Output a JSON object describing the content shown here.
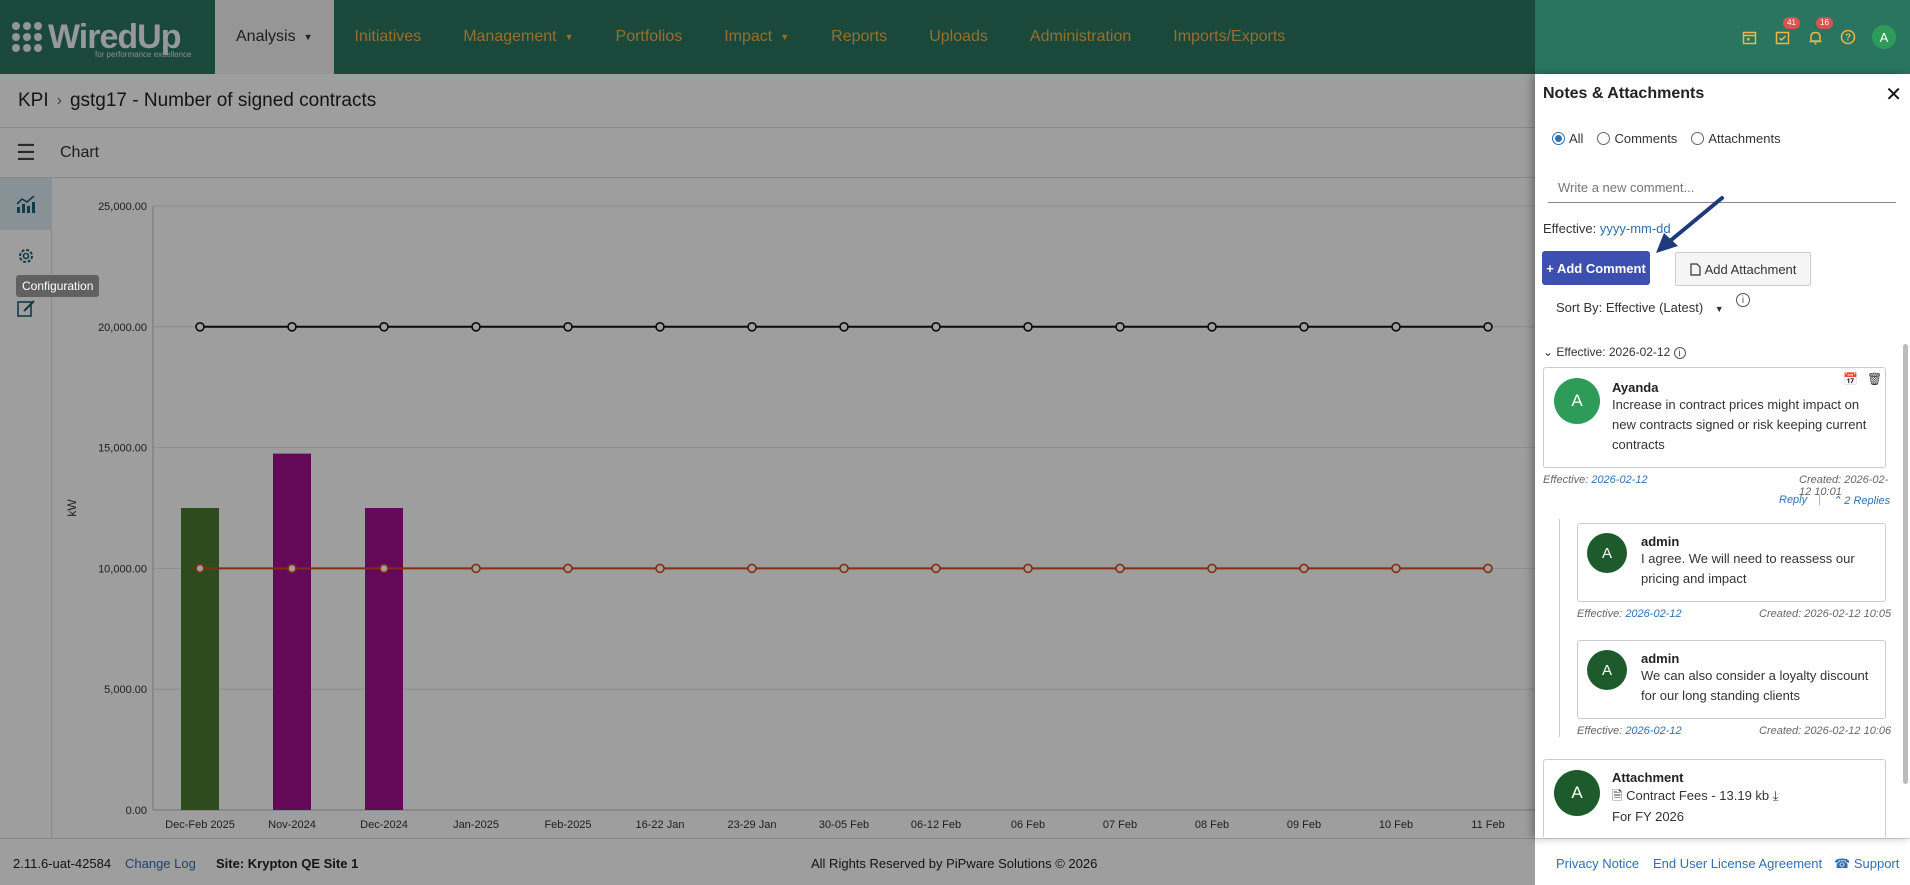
{
  "app": {
    "logo_text": "WiredUp",
    "logo_tagline": "for performance excellence"
  },
  "nav": [
    {
      "label": "Analysis",
      "active": true,
      "caret": true
    },
    {
      "label": "Initiatives"
    },
    {
      "label": "Management",
      "caret": true
    },
    {
      "label": "Portfolios"
    },
    {
      "label": "Impact",
      "caret": true
    },
    {
      "label": "Reports"
    },
    {
      "label": "Uploads"
    },
    {
      "label": "Administration"
    },
    {
      "label": "Imports/Exports"
    }
  ],
  "top_icons": {
    "tasks_badge": "41",
    "notifications_badge": "16",
    "avatar": "A"
  },
  "breadcrumb": {
    "root": "KPI",
    "current": "gstg17 - Number of signed contracts"
  },
  "subheader": {
    "title": "Chart"
  },
  "sidebar": {
    "tooltip": "Configuration",
    "icons": [
      "chart-icon",
      "gear-icon",
      "edit-icon"
    ]
  },
  "chart_data": {
    "type": "bar",
    "ylabel": "kW",
    "ylim": [
      0,
      25000
    ],
    "y_ticks": [
      "0.00",
      "5,000.00",
      "10,000.00",
      "15,000.00",
      "20,000.00",
      "25,000.00"
    ],
    "categories": [
      "Dec-Feb 2025",
      "Nov-2024",
      "Dec-2024",
      "Jan-2025",
      "Feb-2025",
      "16-22 Jan",
      "23-29 Jan",
      "30-05 Feb",
      "06-12 Feb",
      "06 Feb",
      "07 Feb",
      "08 Feb",
      "09 Feb",
      "10 Feb",
      "11 Feb"
    ],
    "bars": [
      {
        "category": "Dec-Feb 2025",
        "value": 12500,
        "color": "#4a7a2e"
      },
      {
        "category": "Nov-2024",
        "value": 14750,
        "color": "#a0108f"
      },
      {
        "category": "Dec-2024",
        "value": 12500,
        "color": "#a0108f"
      }
    ],
    "series": [
      {
        "values": [
          20000,
          20000,
          20000,
          20000,
          20000,
          20000,
          20000,
          20000,
          20000,
          20000,
          20000,
          20000,
          20000,
          20000,
          20000
        ],
        "color": "#111111"
      },
      {
        "values": [
          10000,
          10000,
          10000,
          10000,
          10000,
          10000,
          10000,
          10000,
          10000,
          10000,
          10000,
          10000,
          10000,
          10000,
          10000
        ],
        "color": "#d4491c"
      }
    ]
  },
  "panel": {
    "title": "Notes & Attachments",
    "filters": [
      {
        "label": "All",
        "checked": true
      },
      {
        "label": "Comments",
        "checked": false
      },
      {
        "label": "Attachments",
        "checked": false
      }
    ],
    "comment_placeholder": "Write a new comment...",
    "effective_label": "Effective:",
    "effective_placeholder": "yyyy-mm-dd",
    "add_comment": "+ Add Comment",
    "add_attachment": "Add Attachment",
    "sort_label": "Sort By: Effective (Latest)",
    "group_header": "Effective: 2026-02-12",
    "comment": {
      "author": "Ayanda",
      "avatar": "A",
      "text": "Increase in contract prices might impact on new contracts signed or risk keeping current contracts",
      "eff_label": "Effective:",
      "eff_date": "2026-02-12",
      "created": "Created: 2026-02-12 10:01",
      "reply": "Reply",
      "replies": "2 Replies"
    },
    "replies": [
      {
        "author": "admin",
        "avatar": "A",
        "text": "I agree. We will need to reassess our pricing and impact",
        "eff_label": "Effective:",
        "eff_date": "2026-02-12",
        "created": "Created: 2026-02-12 10:05"
      },
      {
        "author": "admin",
        "avatar": "A",
        "text": "We can also consider a loyalty discount for our long standing clients",
        "eff_label": "Effective:",
        "eff_date": "2026-02-12",
        "created": "Created: 2026-02-12 10:06"
      }
    ],
    "attachment": {
      "author": "Attachment",
      "avatar": "A",
      "file": "Contract Fees - 13.19 kb",
      "note": "For FY 2026"
    }
  },
  "footer": {
    "version": "2.11.6-uat-42584",
    "changelog": "Change Log",
    "site": "Site: Krypton QE Site 1",
    "copyright": "All Rights Reserved by PiPware Solutions © 2026",
    "privacy": "Privacy Notice",
    "eula": "End User License Agreement",
    "support": "Support"
  },
  "colors": {
    "brand": "#2a7560",
    "nav_text": "#f0b44b",
    "accent": "#3d4fb0",
    "link": "#2f6fb5"
  }
}
